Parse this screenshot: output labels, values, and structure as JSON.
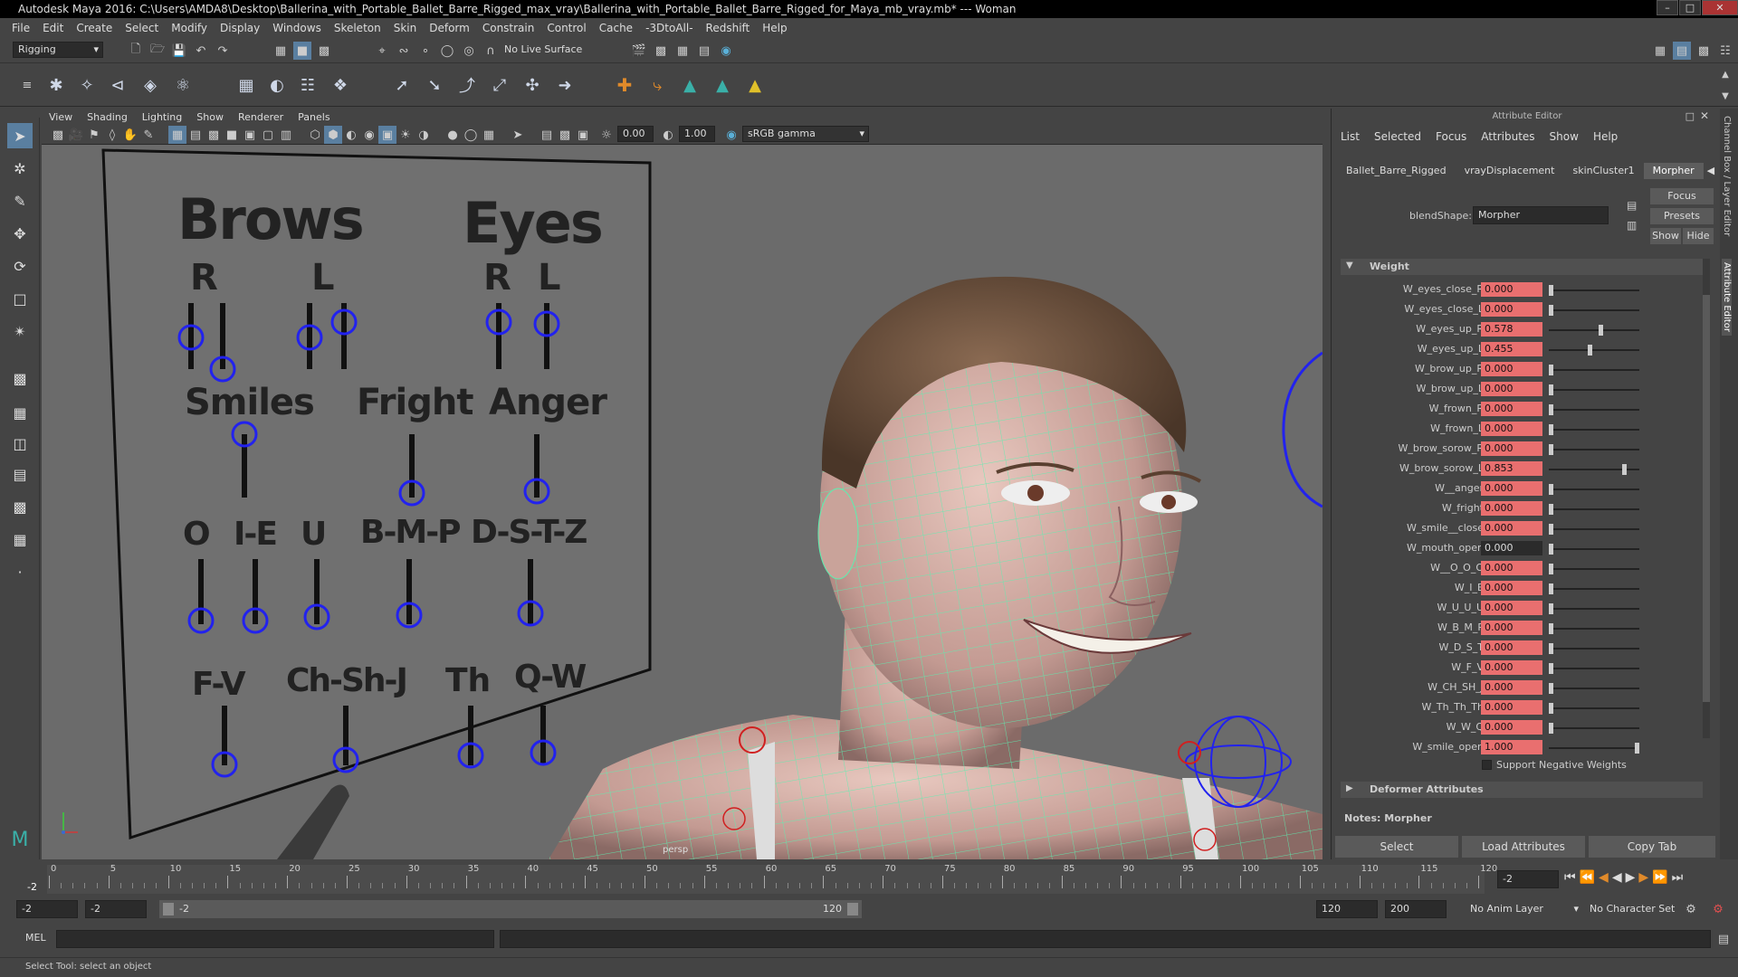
{
  "window": {
    "title": "Autodesk Maya 2016: C:\\Users\\AMDA8\\Desktop\\Ballerina_with_Portable_Ballet_Barre_Rigged_max_vray\\Ballerina_with_Portable_Ballet_Barre_Rigged_for_Maya_mb_vray.mb*   ---   Woman"
  },
  "menubar": [
    "File",
    "Edit",
    "Create",
    "Select",
    "Modify",
    "Display",
    "Windows",
    "Skeleton",
    "Skin",
    "Deform",
    "Constrain",
    "Control",
    "Cache",
    "-3DtoAll-",
    "Redshift",
    "Help"
  ],
  "shelf": {
    "mode": "Rigging",
    "live_surface": "No Live Surface"
  },
  "viewport": {
    "menu": [
      "View",
      "Shading",
      "Lighting",
      "Show",
      "Renderer",
      "Panels"
    ],
    "field1": "0.00",
    "field2": "1.00",
    "color_mgmt": "sRGB gamma",
    "camera_label": "persp",
    "board": {
      "brows": "Brows",
      "eyes": "Eyes",
      "r1": "R",
      "l1": "L",
      "r2": "R",
      "l2": "L",
      "smiles": "Smiles",
      "fright": "Fright",
      "anger": "Anger",
      "o": "O",
      "ie": "I-E",
      "u": "U",
      "bmp": "B-M-P",
      "dstz": "D-S-T-Z",
      "fv": "F-V",
      "chshj": "Ch-Sh-J",
      "th": "Th",
      "qw": "Q-W"
    }
  },
  "attribute_editor": {
    "title": "Attribute Editor",
    "menu": [
      "List",
      "Selected",
      "Focus",
      "Attributes",
      "Show",
      "Help"
    ],
    "tabs": [
      "Ballet_Barre_Rigged",
      "vrayDisplacement",
      "skinCluster1",
      "Morpher"
    ],
    "active_tab": "Morpher",
    "blendshape_label": "blendShape:",
    "blendshape_value": "Morpher",
    "focus_btn": "Focus",
    "presets_btn": "Presets",
    "show_btn": "Show",
    "hide_btn": "Hide",
    "weight_section": "Weight",
    "weights": [
      {
        "name": "W_eyes_close_R",
        "value": "0.000",
        "pos": 0.0
      },
      {
        "name": "W_eyes_close_L",
        "value": "0.000",
        "pos": 0.0
      },
      {
        "name": "W_eyes_up_R",
        "value": "0.578",
        "pos": 0.578
      },
      {
        "name": "W_eyes_up_L",
        "value": "0.455",
        "pos": 0.455
      },
      {
        "name": "W_brow_up_R",
        "value": "0.000",
        "pos": 0.0
      },
      {
        "name": "W_brow_up_L",
        "value": "0.000",
        "pos": 0.0
      },
      {
        "name": "W_frown_R",
        "value": "0.000",
        "pos": 0.0
      },
      {
        "name": "W_frown_L",
        "value": "0.000",
        "pos": 0.0
      },
      {
        "name": "W_brow_sorow_R",
        "value": "0.000",
        "pos": 0.0
      },
      {
        "name": "W_brow_sorow_L",
        "value": "0.853",
        "pos": 0.853
      },
      {
        "name": "W__anger",
        "value": "0.000",
        "pos": 0.0
      },
      {
        "name": "W_fright",
        "value": "0.000",
        "pos": 0.0
      },
      {
        "name": "W_smile__close",
        "value": "0.000",
        "pos": 0.0
      },
      {
        "name": "W_mouth_open",
        "value": "0.000",
        "pos": 0.0,
        "plain": true
      },
      {
        "name": "W__O_O_O",
        "value": "0.000",
        "pos": 0.0
      },
      {
        "name": "W_I_E",
        "value": "0.000",
        "pos": 0.0
      },
      {
        "name": "W_U_U_U",
        "value": "0.000",
        "pos": 0.0
      },
      {
        "name": "W_B_M_P",
        "value": "0.000",
        "pos": 0.0
      },
      {
        "name": "W_D_S_T",
        "value": "0.000",
        "pos": 0.0
      },
      {
        "name": "W_F_V",
        "value": "0.000",
        "pos": 0.0
      },
      {
        "name": "W_CH_SH_J",
        "value": "0.000",
        "pos": 0.0
      },
      {
        "name": "W_Th_Th_Th",
        "value": "0.000",
        "pos": 0.0
      },
      {
        "name": "W_W_Q",
        "value": "0.000",
        "pos": 0.0
      },
      {
        "name": "W_smile_open",
        "value": "1.000",
        "pos": 1.0
      }
    ],
    "support_negative": "Support Negative Weights",
    "deformer_section": "Deformer Attributes",
    "notes": "Notes:  Morpher",
    "buttons": [
      "Select",
      "Load Attributes",
      "Copy Tab"
    ],
    "side_tabs": [
      "Channel Box / Layer Editor",
      "Attribute Editor"
    ]
  },
  "timeline": {
    "ticks": [
      "0",
      "5",
      "10",
      "15",
      "20",
      "25",
      "30",
      "35",
      "40",
      "45",
      "50",
      "55",
      "60",
      "65",
      "70",
      "75",
      "80",
      "85",
      "90",
      "95",
      "100",
      "105",
      "110",
      "115",
      "120"
    ],
    "current_marker": "-2",
    "current_field": "-2"
  },
  "range": {
    "start": "-2",
    "playback_start": "-2",
    "range_start": "-2",
    "range_end": "120",
    "playback_end": "120",
    "end": "200",
    "anim_layer": "No Anim Layer",
    "char_set": "No Character Set"
  },
  "mel": {
    "label": "MEL"
  },
  "help": {
    "text": "Select Tool: select an object"
  }
}
